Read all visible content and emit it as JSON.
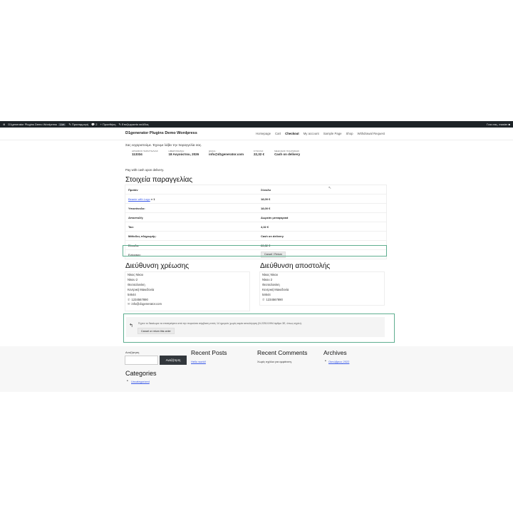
{
  "adminbar": {
    "site": "D1generator Plugins Demo Wordpress",
    "badge": "Live",
    "customize": "Προσαρμογή",
    "comments": "2",
    "new": "Προσθήκη",
    "edit": "Επεξεργασία σελίδας",
    "greeting": "Γεια σας, master"
  },
  "header": {
    "site_title": "D1generator Plugins Demo Wordpress",
    "nav": [
      "Homepage",
      "Cart",
      "Checkout",
      "My account",
      "Sample Page",
      "Shop",
      "Withdrawal Request"
    ],
    "active": "Checkout"
  },
  "thanks": "Σας ευχαριστούμε. Έχουμε λάβει την παραγγελία σας.",
  "overview": [
    {
      "label": "ΑΡΙΘΜΟΣ ΠΑΡΑΓΓΕΛΙΑΣ:",
      "value": "113334"
    },
    {
      "label": "ΗΜΕΡΟΜΗΝΙΑ:",
      "value": "18 Αυγούστου, 2026"
    },
    {
      "label": "EMAIL:",
      "value": "info@d1generator.com"
    },
    {
      "label": "ΣΥΝΟΛΟ:",
      "value": "22,32 €"
    },
    {
      "label": "ΜΕΘΟΔΟΣ ΠΛΗΡΩΜΗΣ:",
      "value": "Cash on delivery"
    }
  ],
  "pay_msg": "Pay with cash upon delivery.",
  "order_details_title": "Στοιχεία παραγγελίας",
  "order_table": {
    "header": [
      "Προϊόν",
      "Σύνολο"
    ],
    "product_name": "Beanie with Logo",
    "product_qty": "× 1",
    "product_total": "18,00 €",
    "rows": [
      [
        "Υποσύνολο:",
        "18,00 €"
      ],
      [
        "Αποστολή:",
        "Δωρεάν μεταφορικά"
      ],
      [
        "Tax:",
        "4,32 €"
      ],
      [
        "Μέθοδος πληρωμής:",
        "Cash on delivery"
      ],
      [
        "Σύνολο:",
        "22,32 €"
      ]
    ],
    "actions_label": "Ενέργειες:",
    "actions_button": "Cancel / Return"
  },
  "billing": {
    "title": "Διεύθυνση χρέωσης",
    "lines": [
      "Νίκος Νίκου",
      "Νίκου 2",
      "Θεσσαλονίκη",
      "Κεντρική Μακεδονία",
      "54644"
    ],
    "phone": "1234567890",
    "email": "info@d1generator.com"
  },
  "shipping": {
    "title": "Διεύθυνση αποστολής",
    "lines": [
      "Νίκος Νίκου",
      "Νίκου 2",
      "Θεσσαλονίκη",
      "Κεντρική Μακεδονία",
      "54644"
    ],
    "phone": "1234567890"
  },
  "return_notice": {
    "text": "Έχετε το δικαίωμα να επιστρέψετε από την παρούσα σύμβαση εντός 14 ημερών χωρίς καμία αιτιολόγηση (Ν.2251/1994 άρθρο 3Ε, όπως ισχύει).",
    "button": "Cancel or return this order"
  },
  "footer": {
    "search_label": "Αναζήτηση",
    "search_button": "Αναζήτηση",
    "recent_posts_title": "Recent Posts",
    "recent_post": "Hello world!",
    "recent_comments_title": "Recent Comments",
    "no_comments": "Χωρίς σχόλια για εμφάνιση.",
    "archives_title": "Archives",
    "archive_item": "Οκτώβριος 2022",
    "categories_title": "Categories",
    "category_item": "Uncategorized"
  }
}
